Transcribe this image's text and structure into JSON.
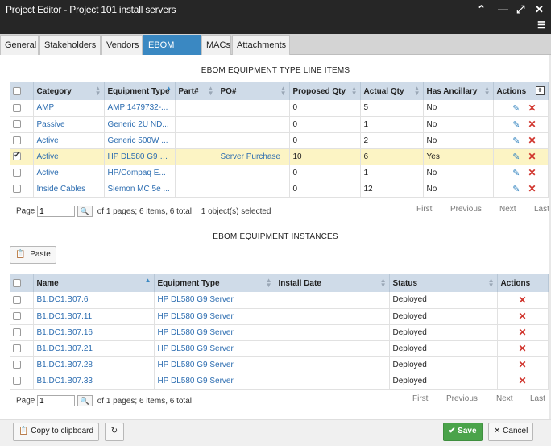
{
  "window": {
    "title": "Project Editor - Project 101 install servers",
    "icons": [
      "chevron-up-icon",
      "minimize-icon",
      "expand-icon",
      "close-icon",
      "menu-icon"
    ]
  },
  "tabs": [
    "General",
    "Stakeholders",
    "Vendors",
    "EBOM Items",
    "MACs",
    "Attachments"
  ],
  "active_tab": "EBOM Items",
  "line_items": {
    "title": "EBOM EQUIPMENT TYPE LINE ITEMS",
    "columns": [
      "Category",
      "Equipment Type",
      "Part#",
      "PO#",
      "Proposed Qty",
      "Actual Qty",
      "Has Ancillary",
      "Actions"
    ],
    "rows": [
      {
        "category": "AMP",
        "equipment_type": "AMP 1479732-...",
        "part": "",
        "po": "",
        "proposed": "0",
        "actual": "5",
        "ancillary": "No",
        "checked": false
      },
      {
        "category": "Passive",
        "equipment_type": "Generic 2U ND...",
        "part": "",
        "po": "",
        "proposed": "0",
        "actual": "1",
        "ancillary": "No",
        "checked": false
      },
      {
        "category": "Active",
        "equipment_type": "Generic 500W ...",
        "part": "",
        "po": "",
        "proposed": "0",
        "actual": "2",
        "ancillary": "No",
        "checked": false
      },
      {
        "category": "Active",
        "equipment_type": "HP DL580 G9 S...",
        "part": "",
        "po": "Server Purchase",
        "proposed": "10",
        "actual": "6",
        "ancillary": "Yes",
        "checked": true
      },
      {
        "category": "Active",
        "equipment_type": "HP/Compaq E...",
        "part": "",
        "po": "",
        "proposed": "0",
        "actual": "1",
        "ancillary": "No",
        "checked": false
      },
      {
        "category": "Inside Cables",
        "equipment_type": "Siemon MC 5e ...",
        "part": "",
        "po": "",
        "proposed": "0",
        "actual": "12",
        "ancillary": "No",
        "checked": false
      }
    ],
    "pager": {
      "page_label": "Page",
      "page_value": "1",
      "info": "of 1 pages; 6 items, 6 total",
      "selected": "1 object(s) selected",
      "first": "First",
      "previous": "Previous",
      "next": "Next",
      "last": "Last"
    }
  },
  "instances": {
    "title": "EBOM EQUIPMENT INSTANCES",
    "paste_label": "Paste",
    "columns": [
      "Name",
      "Equipment Type",
      "Install Date",
      "Status",
      "Actions"
    ],
    "rows": [
      {
        "name": "B1.DC1.B07.6",
        "equipment_type": "HP DL580 G9 Server",
        "install_date": "",
        "status": "Deployed"
      },
      {
        "name": "B1.DC1.B07.11",
        "equipment_type": "HP DL580 G9 Server",
        "install_date": "",
        "status": "Deployed"
      },
      {
        "name": "B1.DC1.B07.16",
        "equipment_type": "HP DL580 G9 Server",
        "install_date": "",
        "status": "Deployed"
      },
      {
        "name": "B1.DC1.B07.21",
        "equipment_type": "HP DL580 G9 Server",
        "install_date": "",
        "status": "Deployed"
      },
      {
        "name": "B1.DC1.B07.28",
        "equipment_type": "HP DL580 G9 Server",
        "install_date": "",
        "status": "Deployed"
      },
      {
        "name": "B1.DC1.B07.33",
        "equipment_type": "HP DL580 G9 Server",
        "install_date": "",
        "status": "Deployed"
      }
    ],
    "pager": {
      "page_label": "Page",
      "page_value": "1",
      "info": "of 1 pages; 6 items, 6 total",
      "first": "First",
      "previous": "Previous",
      "next": "Next",
      "last": "Last"
    }
  },
  "footer": {
    "copy_label": "Copy to clipboard",
    "save_label": "Save",
    "cancel_label": "Cancel"
  },
  "colors": {
    "titlebar": "#262626",
    "active_tab": "#3a88c2",
    "header": "#cfdbe8",
    "selected_row": "#fcf4c4",
    "link": "#2b6cb0",
    "save": "#4aa34a",
    "delete": "#d0342c"
  }
}
